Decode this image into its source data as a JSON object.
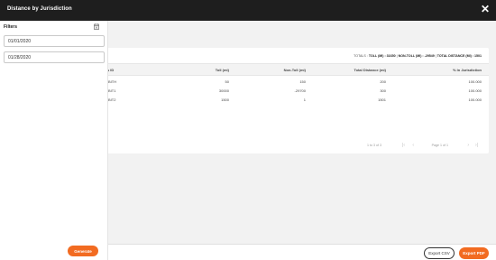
{
  "header": {
    "title": "Distance by Jurisdiction",
    "close_icon": "close-icon"
  },
  "sidebar": {
    "title": "Filters",
    "icon": "calendar-clear-icon",
    "start_date": "01/01/2020",
    "end_date": "01/28/2020",
    "generate_label": "Generate"
  },
  "totals": {
    "prefix": "TOTALS :",
    "toll": "TOLL (MI) : 31650",
    "non_toll": "NON-TOLL (MI) : -29549",
    "total": "TOTAL DISTANCE (MI) : 1501"
  },
  "table": {
    "columns": [
      "’s ID",
      "Toll (mi)",
      "Non-Toll (mi)",
      "Total Distance (mi)",
      "% In Jurisdiction"
    ],
    "rows": [
      [
        "JBITH",
        "50",
        "150",
        "200",
        "100.000"
      ],
      [
        "JBIT1",
        "30000",
        "-29700",
        "300",
        "100.000"
      ],
      [
        "JBIT2",
        "1500",
        "1",
        "1501",
        "100.000"
      ]
    ]
  },
  "pagination": {
    "count": "1 to 3 of 3",
    "page_label": "Page  1  of  1",
    "first": "|‹",
    "prev": "‹",
    "next": "›",
    "last": "›|"
  },
  "actions": {
    "export_csv": "Export CSV",
    "export_pdf": "Export PDF"
  },
  "colors": {
    "accent": "#f26b21",
    "topbar": "#1e1e1e"
  }
}
